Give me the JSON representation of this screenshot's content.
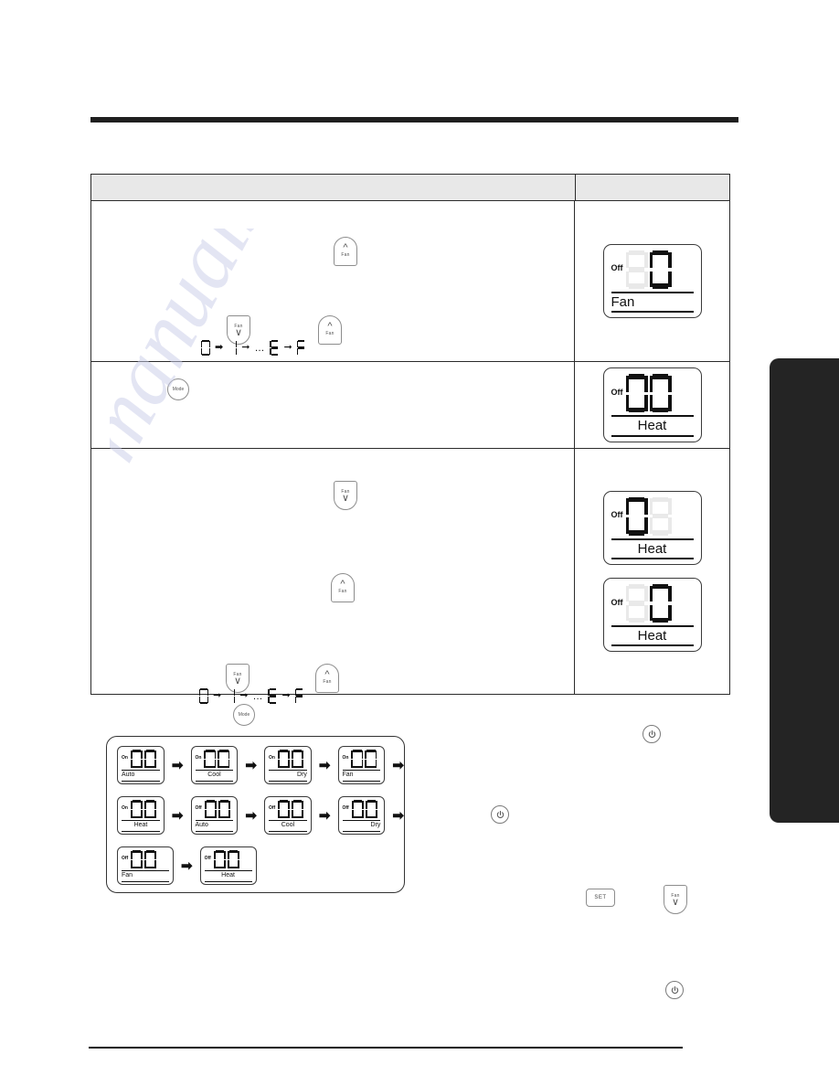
{
  "document": {
    "type": "air-conditioner-remote-controller-manual-page"
  },
  "table": {
    "header": {
      "left": "",
      "right": ""
    },
    "rows": [
      {
        "id": "row-fan-speed",
        "keys": [
          {
            "name": "fan-up-button",
            "label": "Fan",
            "direction": "up"
          },
          {
            "name": "fan-down-button",
            "label": "Fan",
            "direction": "down"
          },
          {
            "name": "fan-up-button-2",
            "label": "Fan",
            "direction": "up"
          }
        ],
        "sequence": [
          "0",
          "1",
          "…",
          "E",
          "F"
        ],
        "displays": [
          {
            "name": "display-off-fan",
            "indicator": "Off",
            "digits": [
              {
                "value": "8",
                "state": "dim"
              },
              {
                "value": "0",
                "state": "on"
              }
            ],
            "label": "Fan",
            "label_align": "l"
          }
        ]
      },
      {
        "id": "row-mode",
        "keys": [
          {
            "name": "mode-button",
            "label": "Mode"
          }
        ],
        "displays": [
          {
            "name": "display-off-heat-00",
            "indicator": "Off",
            "digits": [
              {
                "value": "0",
                "state": "on"
              },
              {
                "value": "0",
                "state": "on"
              }
            ],
            "label": "Heat",
            "label_align": "c"
          }
        ]
      },
      {
        "id": "row-heat-setting",
        "keys": [
          {
            "name": "fan-down-button-2",
            "label": "Fan",
            "direction": "down"
          },
          {
            "name": "fan-up-button-3",
            "label": "Fan",
            "direction": "up"
          },
          {
            "name": "fan-down-button-3",
            "label": "Fan",
            "direction": "down"
          },
          {
            "name": "fan-up-button-4",
            "label": "Fan",
            "direction": "up"
          }
        ],
        "sequence": [
          "0",
          "1",
          "…",
          "E",
          "F"
        ],
        "displays": [
          {
            "name": "display-off-heat-first-digit",
            "indicator": "Off",
            "digits": [
              {
                "value": "0",
                "state": "on"
              },
              {
                "value": "8",
                "state": "dim"
              }
            ],
            "label": "Heat",
            "label_align": "c"
          },
          {
            "name": "display-off-heat-second-digit",
            "indicator": "Off",
            "digits": [
              {
                "value": "8",
                "state": "dim"
              },
              {
                "value": "0",
                "state": "on"
              }
            ],
            "label": "Heat",
            "label_align": "c"
          }
        ]
      }
    ]
  },
  "mode_cycle": {
    "mode_button": {
      "name": "mode-button-cycle",
      "label": "Mode"
    },
    "arrow": "➡",
    "rows": [
      [
        {
          "indicator": "On",
          "label": "Auto",
          "label_align": "l",
          "digits": [
            "0",
            "0"
          ]
        },
        {
          "indicator": "On",
          "label": "Cool",
          "label_align": "c",
          "digits": [
            "0",
            "0"
          ]
        },
        {
          "indicator": "On",
          "label": "Dry",
          "label_align": "r",
          "digits": [
            "0",
            "0"
          ]
        },
        {
          "indicator": "On",
          "label": "Fan",
          "label_align": "l",
          "digits": [
            "0",
            "0"
          ]
        }
      ],
      [
        {
          "indicator": "On",
          "label": "Heat",
          "label_align": "c",
          "digits": [
            "0",
            "0"
          ]
        },
        {
          "indicator": "Off",
          "label": "Auto",
          "label_align": "l",
          "digits": [
            "0",
            "0"
          ]
        },
        {
          "indicator": "Off",
          "label": "Cool",
          "label_align": "c",
          "digits": [
            "0",
            "0"
          ]
        },
        {
          "indicator": "Off",
          "label": "Dry",
          "label_align": "r",
          "digits": [
            "0",
            "0"
          ]
        }
      ],
      [
        {
          "indicator": "Off",
          "label": "Fan",
          "label_align": "l",
          "digits": [
            "0",
            "0"
          ]
        },
        {
          "indicator": "Off",
          "label": "Heat",
          "label_align": "c",
          "digits": [
            "0",
            "0"
          ]
        }
      ]
    ]
  },
  "side_keys": [
    {
      "name": "power-button-top",
      "type": "power"
    },
    {
      "name": "power-button-middle",
      "type": "power"
    },
    {
      "name": "set-button",
      "type": "set",
      "label": "SET"
    },
    {
      "name": "fan-down-button-right",
      "type": "fan-down",
      "label": "Fan"
    },
    {
      "name": "power-button-bottom",
      "type": "power"
    }
  ],
  "colors": {
    "rule": "#1f1f1f",
    "table_border": "#2b2b2b",
    "header_fill": "#e8e8e8",
    "side_tab": "#242424",
    "segment_on": "#111111",
    "segment_dim": "#e9e9e9",
    "watermark": "#c9cce8"
  }
}
